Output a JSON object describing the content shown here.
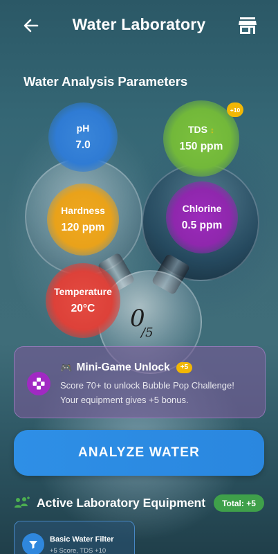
{
  "header": {
    "title": "Water Laboratory",
    "back_icon": "arrow-left-icon",
    "store_icon": "store-icon"
  },
  "parameters": {
    "section_title": "Water Analysis Parameters",
    "ph": {
      "label": "pH",
      "value": "7.0",
      "color": "#2f7bd4"
    },
    "tds": {
      "label": "TDS",
      "trend_glyph": "↕",
      "value": "150 ppm",
      "color": "#72b83a",
      "bonus_badge": "+10"
    },
    "hardness": {
      "label": "Hardness",
      "value": "120 ppm",
      "color": "#e9a21a"
    },
    "chlorine": {
      "label": "Chlorine",
      "value": "0.5 ppm",
      "color": "#8f27ad"
    },
    "temperature": {
      "label": "Temperature",
      "value": "20°C",
      "color": "#dd4139"
    }
  },
  "score": {
    "current": "0",
    "total": "/5"
  },
  "mini_game": {
    "title": "Mini-Game Unlock",
    "badge": "+5",
    "line1": "Score 70+ to unlock Bubble Pop Challenge!",
    "line2": "Your equipment gives +5 bonus.",
    "icon": "gamepad-icon",
    "accent": "#a129c3"
  },
  "analyze_button": {
    "label": "ANALYZE WATER",
    "color": "#2e8fe6"
  },
  "equipment": {
    "title": "Active Laboratory Equipment",
    "total_badge": "Total: +5",
    "items": [
      {
        "name": "Basic Water Filter",
        "desc": "+5 Score, TDS +10",
        "icon": "filter-icon"
      }
    ]
  }
}
